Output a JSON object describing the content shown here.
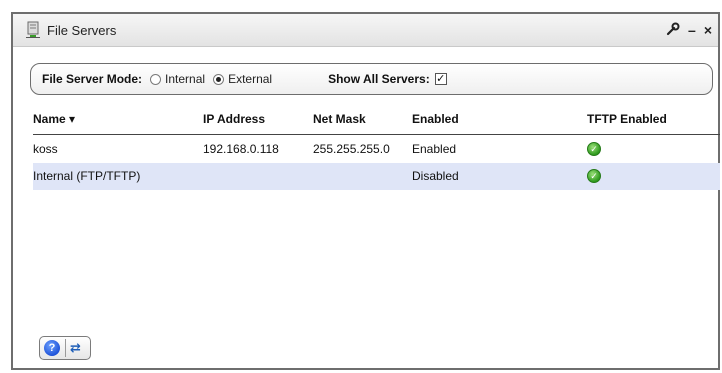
{
  "window": {
    "title": "File Servers",
    "tools": {
      "wrench": "⚒",
      "minimize": "–",
      "close": "×"
    }
  },
  "mode_bar": {
    "mode_label": "File Server Mode:",
    "options": [
      {
        "label": "Internal",
        "selected": false
      },
      {
        "label": "External",
        "selected": true
      }
    ],
    "show_all_label": "Show All Servers:",
    "show_all_checked": true,
    "show_all_mark": "✓"
  },
  "table": {
    "columns": [
      "Name ▾",
      "IP Address",
      "Net Mask",
      "Enabled",
      "TFTP Enabled"
    ],
    "rows": [
      {
        "name": "koss",
        "ip": "192.168.0.118",
        "mask": "255.255.255.0",
        "enabled": "Enabled",
        "tftp": true
      },
      {
        "name": "Internal (FTP/TFTP)",
        "ip": "",
        "mask": "",
        "enabled": "Disabled",
        "tftp": true
      }
    ],
    "check_glyph": "✓"
  },
  "footer": {
    "help_glyph": "?",
    "refresh_glyph": "⇄"
  },
  "colors": {
    "selected_row": "#dfe5f7",
    "check_green": "#2f9a1e",
    "help_blue": "#1a4ed6"
  }
}
